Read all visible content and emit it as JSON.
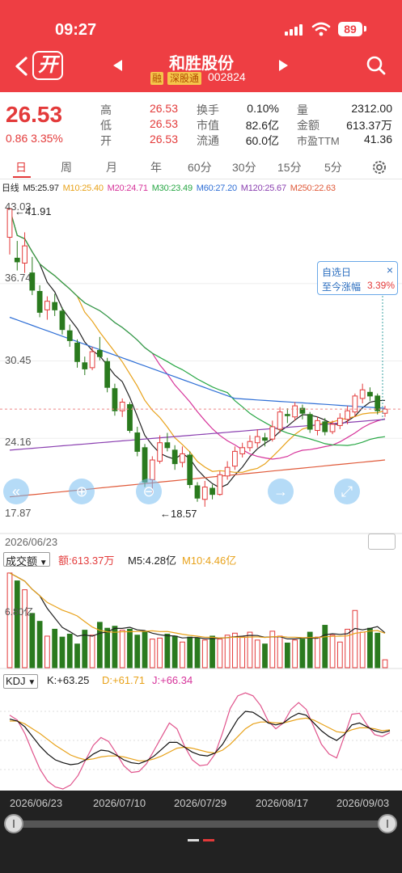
{
  "status": {
    "time": "09:27",
    "battery": "89"
  },
  "header": {
    "open_badge": "开",
    "stock_name": "和胜股份",
    "tag_rong": "融",
    "tag_sgt": "深股通",
    "stock_code": "002824"
  },
  "quote": {
    "price": "26.53",
    "change": "0.86 3.35%",
    "high_label": "高",
    "high": "26.53",
    "low_label": "低",
    "low": "26.53",
    "open_label": "开",
    "open": "26.53",
    "turnover_label": "换手",
    "turnover": "0.10%",
    "mktcap_label": "市值",
    "mktcap": "82.6亿",
    "float_label": "流通",
    "float": "60.0亿",
    "volume_label": "量",
    "volume": "2312.00",
    "amount_label": "金额",
    "amount": "613.37万",
    "pe_label": "市盈TTM",
    "pe": "41.36"
  },
  "tabs": [
    "日",
    "周",
    "月",
    "年",
    "60分",
    "30分",
    "15分",
    "5分"
  ],
  "ma": {
    "label": "日线",
    "m5": "M5:25.97",
    "m10": "M10:25.40",
    "m20": "M20:24.71",
    "m30": "M30:23.49",
    "m60": "M60:27.20",
    "m120": "M120:25.67",
    "m250": "M250:22.63",
    "colors": {
      "m5": "#222222",
      "m10": "#e8a21a",
      "m20": "#d6339a",
      "m30": "#28a745",
      "m60": "#2f6fd6",
      "m120": "#8a3fb0",
      "m250": "#e05a3a"
    }
  },
  "chart": {
    "y_labels": [
      "43.03",
      "36.74",
      "30.45",
      "24.16",
      "17.87"
    ],
    "high_marker": "←41.91",
    "low_marker": "←18.57",
    "tooltip_title": "自选日",
    "tooltip_label": "至今涨幅",
    "tooltip_value": "3.39%",
    "tooltip_close": "×",
    "nav": [
      "«",
      "⊕",
      "⊖",
      "→",
      "⤢"
    ]
  },
  "chart_data": {
    "type": "candlestick",
    "ylim": [
      17.87,
      43.03
    ],
    "candles": [
      [
        40.5,
        42.8,
        42.9,
        39.1
      ],
      [
        38.8,
        38.5,
        40.2,
        37.8
      ],
      [
        38.4,
        39.8,
        40.9,
        37.6
      ],
      [
        37.6,
        36.2,
        38.9,
        35.8
      ],
      [
        36.1,
        34.4,
        36.6,
        34.0
      ],
      [
        34.6,
        35.3,
        35.7,
        33.8
      ],
      [
        35.2,
        34.6,
        35.9,
        34.1
      ],
      [
        34.5,
        33.0,
        34.8,
        32.6
      ],
      [
        32.9,
        32.1,
        33.4,
        31.6
      ],
      [
        31.9,
        30.4,
        32.2,
        29.9
      ],
      [
        30.3,
        29.8,
        30.8,
        29.3
      ],
      [
        29.9,
        31.2,
        31.6,
        29.7
      ],
      [
        31.3,
        30.8,
        32.4,
        30.5
      ],
      [
        30.4,
        28.3,
        30.7,
        27.9
      ],
      [
        28.2,
        26.4,
        28.6,
        26.0
      ],
      [
        26.4,
        27.1,
        27.4,
        25.9
      ],
      [
        26.9,
        24.8,
        27.1,
        24.6
      ],
      [
        24.6,
        23.1,
        25.1,
        22.7
      ],
      [
        23.4,
        20.6,
        23.7,
        20.2
      ],
      [
        20.8,
        22.4,
        22.7,
        19.6
      ],
      [
        22.3,
        23.8,
        24.4,
        22.1
      ],
      [
        23.8,
        23.4,
        24.6,
        23.1
      ],
      [
        23.2,
        22.1,
        23.6,
        21.6
      ],
      [
        22.2,
        22.9,
        23.5,
        21.8
      ],
      [
        22.8,
        20.4,
        23.1,
        20.1
      ],
      [
        20.3,
        19.3,
        20.6,
        19.0
      ],
      [
        19.2,
        20.2,
        20.7,
        18.6
      ],
      [
        20.1,
        19.6,
        20.4,
        19.2
      ],
      [
        19.6,
        21.2,
        21.5,
        19.5
      ],
      [
        21.1,
        21.8,
        22.3,
        20.8
      ],
      [
        21.9,
        23.1,
        23.5,
        21.6
      ],
      [
        22.9,
        23.4,
        23.8,
        22.6
      ],
      [
        23.4,
        23.9,
        24.4,
        23.1
      ],
      [
        23.8,
        24.3,
        24.9,
        23.4
      ],
      [
        24.2,
        24.0,
        24.6,
        23.5
      ],
      [
        24.1,
        25.1,
        25.6,
        23.9
      ],
      [
        24.9,
        26.3,
        26.7,
        24.6
      ],
      [
        26.1,
        26.0,
        26.6,
        25.4
      ],
      [
        25.9,
        26.8,
        27.1,
        25.6
      ],
      [
        26.6,
        26.2,
        26.9,
        25.7
      ],
      [
        26.1,
        24.9,
        26.3,
        24.6
      ],
      [
        24.8,
        25.6,
        25.9,
        24.4
      ],
      [
        25.5,
        24.7,
        25.8,
        24.4
      ],
      [
        24.7,
        25.3,
        25.6,
        24.5
      ],
      [
        25.2,
        25.8,
        26.2,
        24.9
      ],
      [
        25.7,
        26.4,
        26.8,
        25.3
      ],
      [
        26.3,
        27.6,
        27.8,
        25.9
      ],
      [
        27.4,
        28.1,
        28.6,
        27.0
      ],
      [
        27.9,
        27.6,
        28.3,
        27.2
      ],
      [
        27.6,
        26.4,
        27.8,
        26.1
      ],
      [
        26.2,
        26.53,
        26.8,
        25.9
      ]
    ]
  },
  "volume": {
    "date_left": "2026/06/23",
    "selector": "成交额",
    "amount": "额:613.37万",
    "m5": "M5:4.28亿",
    "m10": "M10:4.46亿",
    "y_label": "6.80亿",
    "bars": [
      9.6,
      8.8,
      7.9,
      5.5,
      4.7,
      3.2,
      3.9,
      3.1,
      3.4,
      2.4,
      3.8,
      3.3,
      4.6,
      4.0,
      4.2,
      3.8,
      3.9,
      3.3,
      3.6,
      2.9,
      3.0,
      3.4,
      3.2,
      2.6,
      3.1,
      3.0,
      2.8,
      3.2,
      2.9,
      3.3,
      3.5,
      3.1,
      3.6,
      2.8,
      2.4,
      3.7,
      3.2,
      2.5,
      2.8,
      2.9,
      3.6,
      3.1,
      4.3,
      3.3,
      2.6,
      3.9,
      5.8,
      3.6,
      4.0,
      3.5,
      0.8
    ]
  },
  "kdj": {
    "selector": "KDJ",
    "k": "K:+63.25",
    "d": "D:+61.71",
    "j": "J:+66.34",
    "k_values": [
      72,
      70,
      64,
      54,
      44,
      36,
      30,
      27,
      25,
      26,
      30,
      36,
      40,
      39,
      35,
      30,
      27,
      26,
      29,
      34,
      41,
      48,
      48,
      43,
      38,
      35,
      34,
      37,
      46,
      59,
      72,
      80,
      79,
      74,
      68,
      66,
      68,
      74,
      78,
      76,
      68,
      60,
      54,
      50,
      56,
      66,
      68,
      64,
      60,
      58,
      60
    ],
    "d_values": [
      70,
      70,
      67,
      62,
      57,
      51,
      45,
      40,
      35,
      32,
      30,
      31,
      33,
      34,
      34,
      33,
      31,
      29,
      29,
      31,
      34,
      38,
      42,
      43,
      42,
      40,
      38,
      37,
      40,
      46,
      54,
      62,
      67,
      69,
      69,
      68,
      68,
      70,
      72,
      73,
      71,
      67,
      63,
      59,
      58,
      61,
      63,
      63,
      62,
      60,
      61
    ],
    "j_values": [
      76,
      71,
      57,
      38,
      20,
      8,
      2,
      0,
      4,
      14,
      30,
      45,
      53,
      49,
      37,
      24,
      17,
      18,
      26,
      40,
      54,
      68,
      62,
      44,
      30,
      24,
      25,
      36,
      58,
      83,
      96,
      99,
      96,
      86,
      70,
      62,
      68,
      82,
      89,
      82,
      64,
      46,
      36,
      32,
      54,
      77,
      78,
      66,
      56,
      54,
      58
    ]
  },
  "bottom": {
    "dates": [
      "2026/06/23",
      "2026/07/10",
      "2026/07/29",
      "2026/08/17",
      "2026/09/03"
    ]
  }
}
